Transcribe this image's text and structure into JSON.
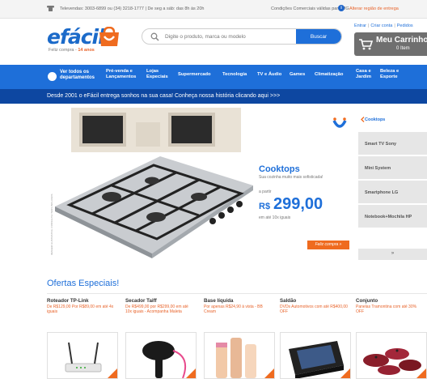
{
  "topbar": {
    "phone": "Televendas: 3003-6899 ou (34) 3218-1777 | De seg a sáb: das 8h às 20h",
    "conditions": "Condições Comerciais válidas para MG",
    "region": "Alterar região de entrega"
  },
  "header": {
    "logo": "efácil",
    "tagline": "Feliz compra -",
    "tagline_highlight": "14 anos",
    "search_placeholder": "Digite o produto, marca ou modelo",
    "search_button": "Buscar",
    "login": "Entrar",
    "register": "Criar conta",
    "orders": "Pedidos",
    "cart_title": "Meu Carrinho",
    "cart_count": "0 Item"
  },
  "nav": {
    "all": "Ver todos os departamentos",
    "items": [
      "Pré-venda e Lançamentos",
      "Lojas Especiais",
      "Supermercado",
      "Tecnologia",
      "TV e Áudio",
      "Games",
      "Climatização",
      "Casa e Jardim",
      "Beleza e Esporte"
    ]
  },
  "banner_strip": "Desde 2001 o eFácil entrega sonhos na sua casa! Conheça nossa história clicando aqui >>>",
  "hero": {
    "title": "Cooktops",
    "subtitle": "Sua cozinha muito mais sofisticada!",
    "from": "a partir",
    "currency": "R$",
    "price": "299,00",
    "installments": "em até 10x iguais",
    "cta": "Feliz compra »",
    "vertical_note": "IMAGEM ILUSTRATIVA. CONSULTE ITENS INCLUSOS"
  },
  "side_tabs": [
    "Cooktops",
    "Smart TV Sony",
    "Mini System",
    "Smartphone LG",
    "Notebook+Mochila HP"
  ],
  "side_more": "»",
  "offers": {
    "title": "Ofertas Especiais!",
    "items": [
      {
        "name": "Roteador TP-Link",
        "desc": "De R$129,00 Por R$89,00 em até 4x iguais"
      },
      {
        "name": "Secador Taiff",
        "desc": "De R$499,00 por R$299,00 em até 10x iguais - Acompanha Maleta"
      },
      {
        "name": "Base líquida",
        "desc": "Por apenas R$24,90 à vista - BB Cream"
      },
      {
        "name": "Saldão",
        "desc": "DVDs Automotivos com até R$400,00 OFF"
      },
      {
        "name": "Conjunto",
        "desc": "Panelas Tramontina com até 30% OFF"
      }
    ]
  },
  "colors": {
    "brand_blue": "#1e6fd9",
    "dark_blue": "#0d47a1",
    "orange": "#ef6b1f"
  }
}
